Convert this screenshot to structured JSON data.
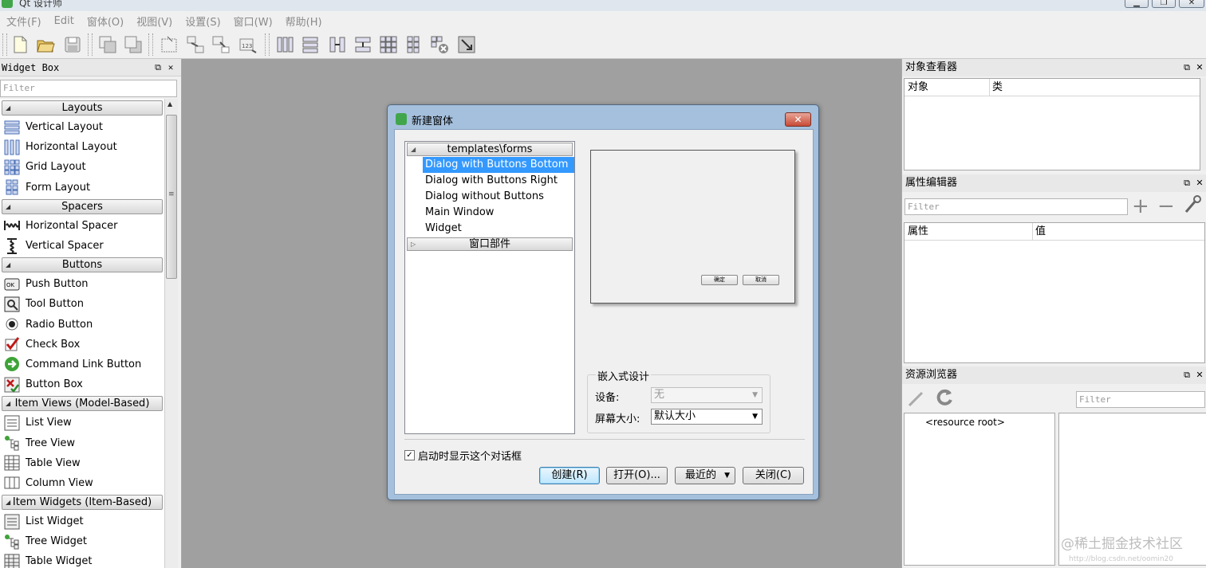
{
  "app": {
    "title": "Qt 设计师",
    "min": "▁",
    "max": "❐",
    "close": "✕"
  },
  "menu": [
    "文件(F)",
    "Edit",
    "窗体(O)",
    "视图(V)",
    "设置(S)",
    "窗口(W)",
    "帮助(H)"
  ],
  "widget_box": {
    "title": "Widget Box",
    "filter_placeholder": "Filter",
    "float_glyph": "⧉",
    "close_glyph": "✕",
    "sections": [
      {
        "label": "Layouts",
        "items": [
          "Vertical Layout",
          "Horizontal Layout",
          "Grid Layout",
          "Form Layout"
        ]
      },
      {
        "label": "Spacers",
        "items": [
          "Horizontal Spacer",
          "Vertical Spacer"
        ]
      },
      {
        "label": "Buttons",
        "items": [
          "Push Button",
          "Tool Button",
          "Radio Button",
          "Check Box",
          "Command Link Button",
          "Button Box"
        ]
      },
      {
        "label": "Item Views (Model-Based)",
        "items": [
          "List View",
          "Tree View",
          "Table View",
          "Column View"
        ]
      },
      {
        "label": "Item Widgets (Item-Based)",
        "items": [
          "List Widget",
          "Tree Widget",
          "Table Widget"
        ]
      }
    ]
  },
  "object_inspector": {
    "title": "对象查看器",
    "col1": "对象",
    "col2": "类"
  },
  "property_editor": {
    "title": "属性编辑器",
    "filter_placeholder": "Filter",
    "col1": "属性",
    "col2": "值"
  },
  "resource_browser": {
    "title": "资源浏览器",
    "filter_placeholder": "Filter",
    "root": "<resource root>"
  },
  "dialog": {
    "title": "新建窗体",
    "close": "✕",
    "template_category": "templates\\forms",
    "templates": [
      "Dialog with Buttons Bottom",
      "Dialog with Buttons Right",
      "Dialog without Buttons",
      "Main Window",
      "Widget"
    ],
    "selected_index": 0,
    "widgets_category": "窗口部件",
    "preview_ok": "确定",
    "preview_cancel": "取消",
    "embedded_label": "嵌入式设计",
    "device_label": "设备:",
    "device_value": "无",
    "screen_label": "屏幕大小:",
    "screen_value": "默认大小",
    "show_on_startup": "启动时显示这个对话框",
    "show_on_startup_checked": true,
    "btn_create": "创建(R)",
    "btn_open": "打开(O)...",
    "btn_recent": "最近的",
    "btn_close": "关闭(C)"
  },
  "watermark": "@稀土掘金技术社区",
  "watermark_url": "http://blog.csdn.net/oomin20"
}
